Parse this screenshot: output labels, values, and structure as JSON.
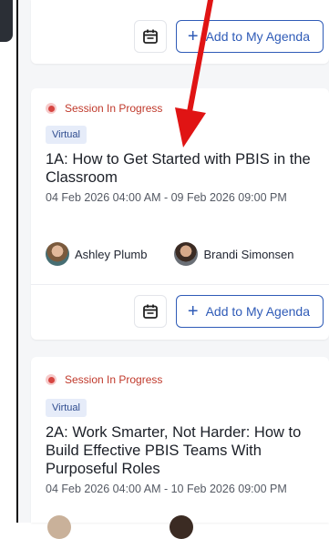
{
  "agenda": {
    "add_label": "Add to My Agenda"
  },
  "sessions": [
    {
      "status": "Session In Progress",
      "tag": "Virtual",
      "title": "1A: How to Get Started with PBIS in the Classroom",
      "dates": "04 Feb 2026 04:00 AM - 09 Feb 2026 09:00 PM",
      "speakers": [
        "Ashley Plumb",
        "Brandi Simonsen"
      ]
    },
    {
      "status": "Session In Progress",
      "tag": "Virtual",
      "title": "2A: Work Smarter, Not Harder: How to Build Effective PBIS Teams With Purposeful Roles",
      "dates": "04 Feb 2026 04:00 AM - 10 Feb 2026 09:00 PM"
    }
  ],
  "colors": {
    "accent": "#2f5bb7",
    "status_red": "#d64541",
    "annotation_arrow": "#e01414"
  },
  "icons": {
    "calendar": "calendar-icon",
    "plus": "plus-icon",
    "status": "status-dot-icon"
  }
}
